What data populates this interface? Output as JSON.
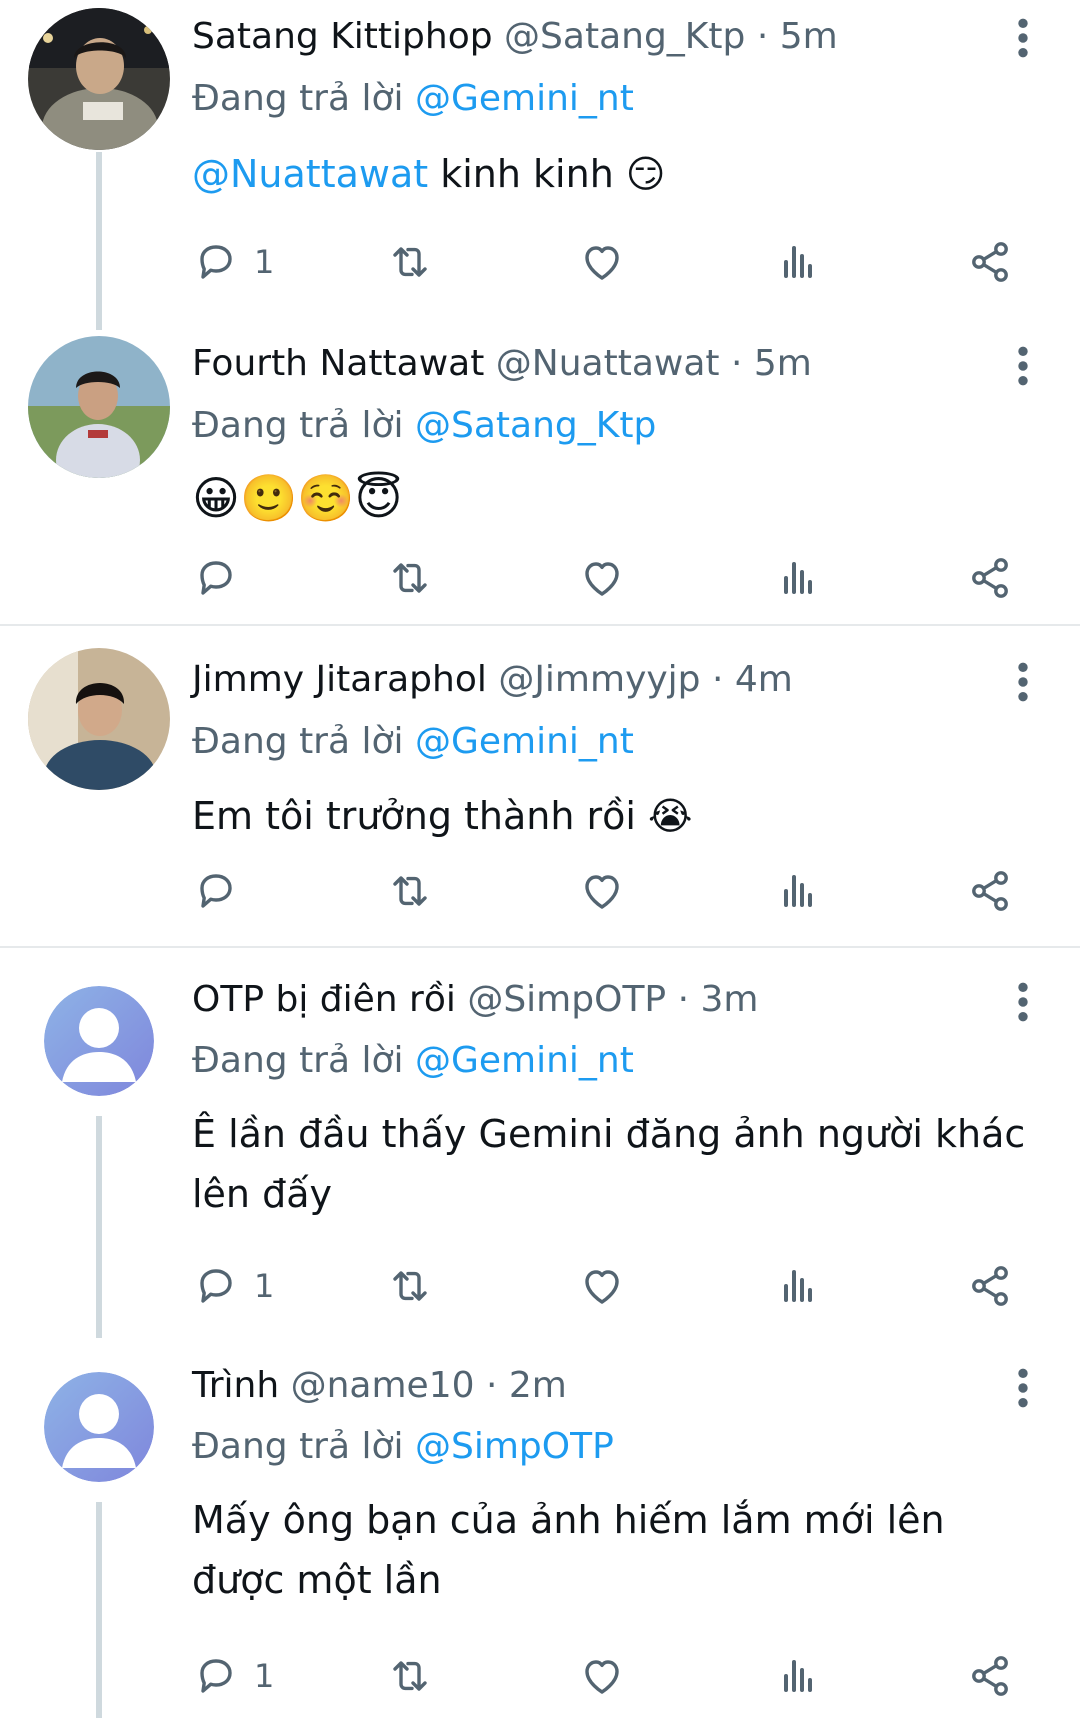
{
  "icons": {
    "reply": "speech-bubble-icon",
    "retweet": "retweet-icon",
    "like": "heart-icon",
    "views": "bar-chart-icon",
    "share": "share-icon",
    "more": "vertical-dots-icon"
  },
  "colors": {
    "link": "#1d9bf0",
    "secondary": "#536471",
    "text": "#0f1419",
    "thread_line": "#cfd9de",
    "divider": "#e6e9eb"
  },
  "tweets": [
    {
      "name": "Satang Kittiphop",
      "handle": "@Satang_Ktp",
      "dot": "·",
      "time": "5m",
      "reply_prefix": "Đang trả lời",
      "reply_to": "@Gemini_nt",
      "mention": "@Nuattawat",
      "text": " kinh kinh 😏",
      "reply_count": "1"
    },
    {
      "name": "Fourth Nattawat",
      "handle": "@Nuattawat",
      "dot": "·",
      "time": "5m",
      "reply_prefix": "Đang trả lời",
      "reply_to": "@Satang_Ktp",
      "text": "😀🙂☺️😇",
      "reply_count": ""
    },
    {
      "name": "Jimmy Jitaraphol",
      "handle": "@Jimmyyjp",
      "dot": "·",
      "time": "4m",
      "reply_prefix": "Đang trả lời",
      "reply_to": "@Gemini_nt",
      "text": "Em tôi trưởng thành rồi 😭",
      "reply_count": ""
    },
    {
      "name": "OTP bị điên rồi",
      "handle": "@SimpOTP",
      "dot": "·",
      "time": "3m",
      "reply_prefix": "Đang trả lời",
      "reply_to": "@Gemini_nt",
      "text": "Ê lần đầu thấy Gemini đăng ảnh người khác lên đấy",
      "reply_count": "1"
    },
    {
      "name": "Trình",
      "handle": "@name10",
      "dot": "·",
      "time": "2m",
      "reply_prefix": "Đang trả lời",
      "reply_to": "@SimpOTP",
      "text": "Mấy ông bạn của ảnh hiếm lắm mới lên được một lần",
      "reply_count": "1"
    }
  ]
}
